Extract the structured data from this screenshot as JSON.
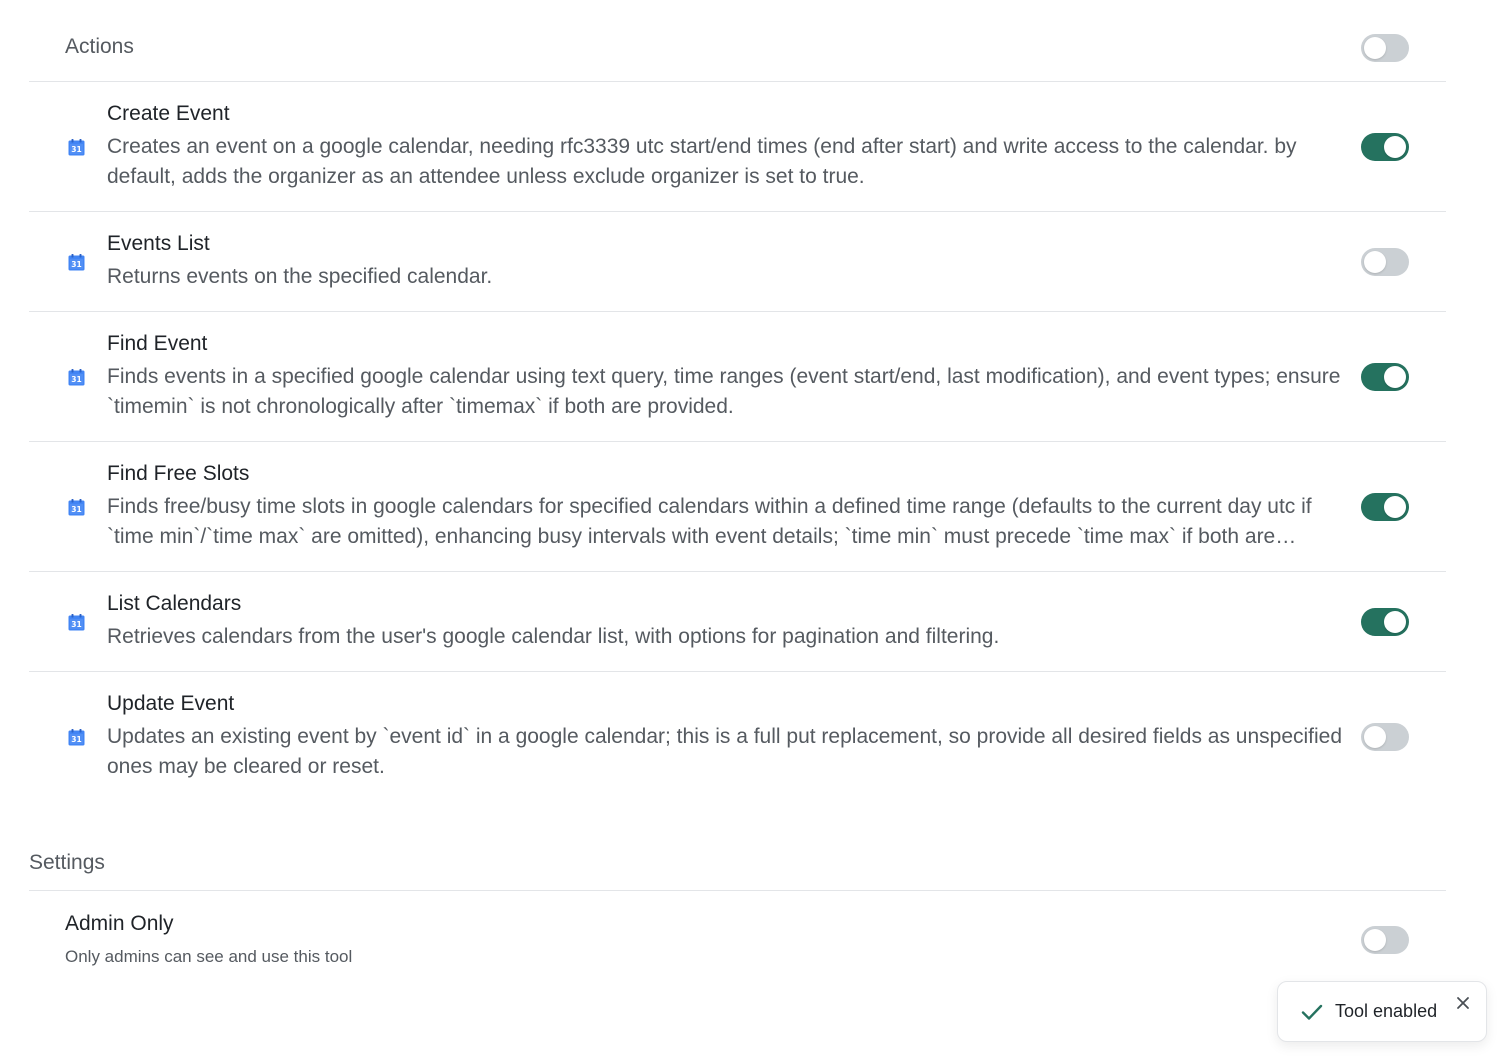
{
  "actions": {
    "title": "Actions",
    "master_toggle_on": false,
    "items": [
      {
        "name": "Create Event",
        "description": "Creates an event on a google calendar, needing rfc3339 utc start/end times (end after start) and write access to the calendar. by default, adds the organizer as an attendee unless exclude organizer is set to true.",
        "enabled": true,
        "icon": "google-calendar-icon"
      },
      {
        "name": "Events List",
        "description": "Returns events on the specified calendar.",
        "enabled": false,
        "icon": "google-calendar-icon"
      },
      {
        "name": "Find Event",
        "description": "Finds events in a specified google calendar using text query, time ranges (event start/end, last modification), and event types; ensure `timemin` is not chronologically after `timemax` if both are provided.",
        "enabled": true,
        "icon": "google-calendar-icon"
      },
      {
        "name": "Find Free Slots",
        "description": "Finds free/busy time slots in google calendars for specified calendars within a defined time range (defaults to the current day utc if `time min`/`time max` are omitted), enhancing busy intervals with event details; `time min` must precede `time max` if both are provided.",
        "enabled": true,
        "icon": "google-calendar-icon"
      },
      {
        "name": "List Calendars",
        "description": "Retrieves calendars from the user's google calendar list, with options for pagination and filtering.",
        "enabled": true,
        "icon": "google-calendar-icon"
      },
      {
        "name": "Update Event",
        "description": "Updates an existing event by `event id` in a google calendar; this is a full put replacement, so provide all desired fields as unspecified ones may be cleared or reset.",
        "enabled": false,
        "icon": "google-calendar-icon"
      }
    ]
  },
  "settings": {
    "title": "Settings",
    "admin_only": {
      "name": "Admin Only",
      "description": "Only admins can see and use this tool",
      "enabled": false
    }
  },
  "toast": {
    "message": "Tool enabled",
    "icon": "check-icon",
    "close_icon": "close-icon"
  },
  "colors": {
    "toggle_on": "#25725f",
    "toggle_off": "#cbd0d4",
    "calendar_blue": "#4285f4",
    "check_green": "#25725f"
  }
}
